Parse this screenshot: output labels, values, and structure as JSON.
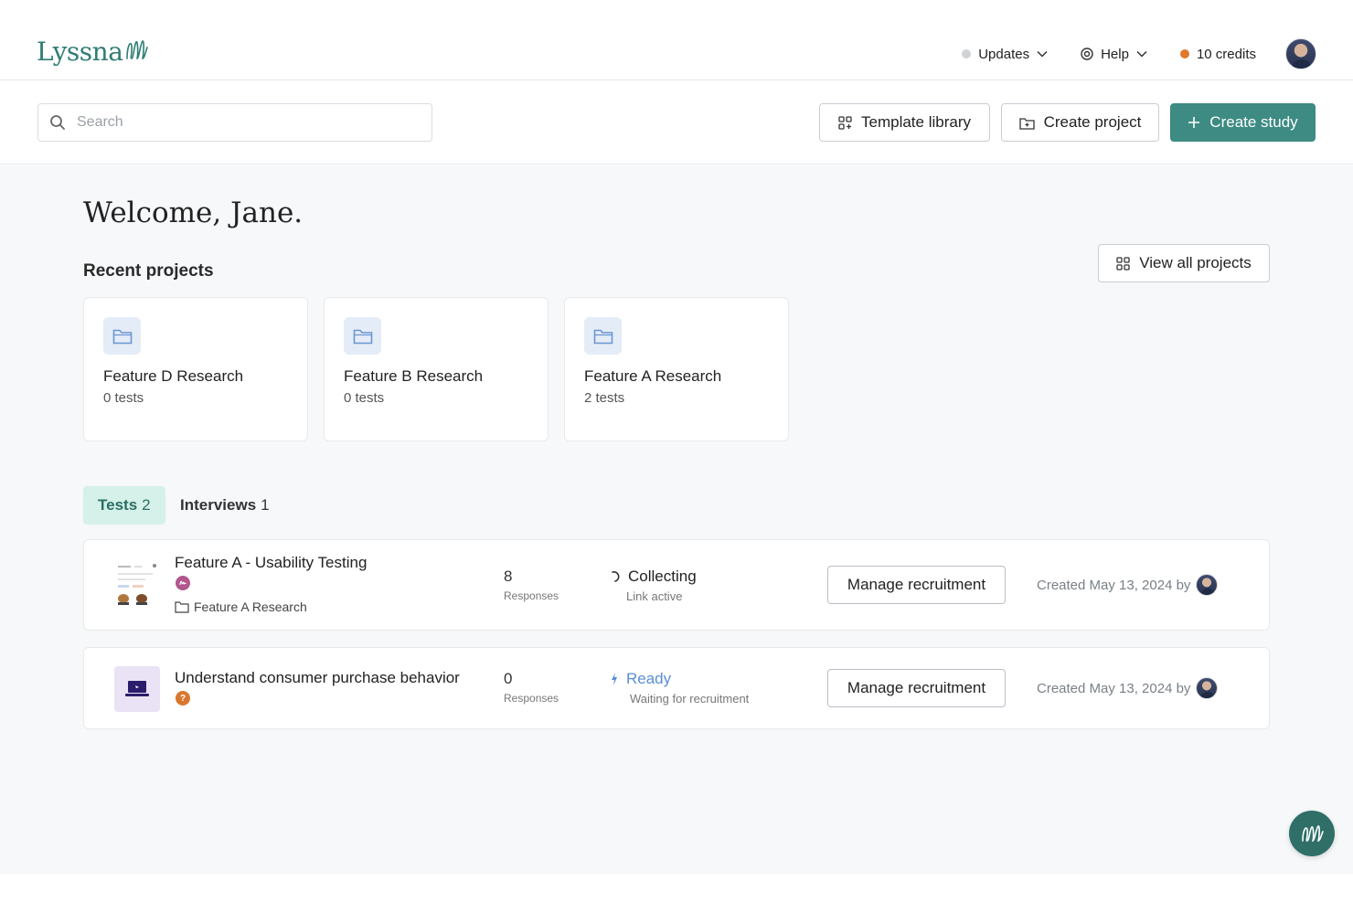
{
  "app": {
    "logo_text": "Lyssna"
  },
  "topnav": {
    "updates_label": "Updates",
    "help_label": "Help",
    "credits_label": "10 credits"
  },
  "toolbar": {
    "search_placeholder": "Search",
    "template_library_label": "Template library",
    "create_project_label": "Create project",
    "create_study_label": "Create study"
  },
  "main": {
    "welcome": "Welcome, Jane.",
    "recent_projects_title": "Recent projects",
    "view_all_label": "View all projects",
    "projects": [
      {
        "name": "Feature D Research",
        "count": "0 tests"
      },
      {
        "name": "Feature B Research",
        "count": "0 tests"
      },
      {
        "name": "Feature A Research",
        "count": "2 tests"
      }
    ],
    "tabs": [
      {
        "label": "Tests",
        "count": "2"
      },
      {
        "label": "Interviews",
        "count": "1"
      }
    ],
    "studies": [
      {
        "title": "Feature A - Usability Testing",
        "project": "Feature A Research",
        "responses": "8",
        "responses_label": "Responses",
        "status": "Collecting",
        "status_sub": "Link active",
        "manage_label": "Manage recruitment",
        "created": "Created May 13, 2024 by",
        "badge_color": "#b0578d"
      },
      {
        "title": "Understand consumer purchase behavior",
        "responses": "0",
        "responses_label": "Responses",
        "status": "Ready",
        "status_sub": "Waiting for recruitment",
        "manage_label": "Manage recruitment",
        "created": "Created May 13, 2024 by",
        "badge_color": "#d9772e"
      }
    ]
  },
  "colors": {
    "brand": "#3d8b82",
    "tab_active_bg": "#d5f1e9",
    "ready_blue": "#5b8fd6",
    "credits_dot": "#e07a2e"
  }
}
